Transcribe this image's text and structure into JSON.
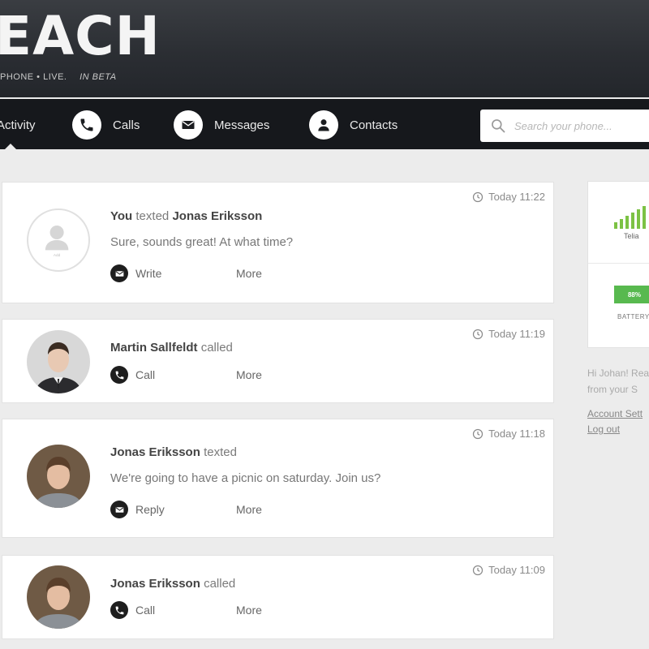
{
  "app": {
    "logo": "EACH",
    "tagline": "PHONE • LIVE.",
    "beta": "IN BETA"
  },
  "nav": {
    "items": [
      {
        "label": "Activity",
        "icon": "activity-icon",
        "active": true
      },
      {
        "label": "Calls",
        "icon": "phone-icon"
      },
      {
        "label": "Messages",
        "icon": "envelope-icon"
      },
      {
        "label": "Contacts",
        "icon": "person-icon"
      }
    ]
  },
  "search": {
    "placeholder": "Search your phone..."
  },
  "feed": [
    {
      "timestamp": "Today 11:22",
      "actor": "You",
      "verb": "texted",
      "target": "Jonas Eriksson",
      "message": "Sure, sounds great! At what time?",
      "action": "Write",
      "action_icon": "envelope-icon",
      "more": "More",
      "avatar": "placeholder"
    },
    {
      "timestamp": "Today 11:19",
      "actor": "Martin Sallfeldt",
      "verb": "called",
      "message": "",
      "action": "Call",
      "action_icon": "phone-icon",
      "more": "More",
      "avatar": "photo-martin"
    },
    {
      "timestamp": "Today 11:18",
      "actor": "Jonas Eriksson",
      "verb": "texted",
      "message": "We're going to have a picnic on saturday. Join us?",
      "action": "Reply",
      "action_icon": "envelope-icon",
      "more": "More",
      "avatar": "photo-jonas"
    },
    {
      "timestamp": "Today 11:09",
      "actor": "Jonas Eriksson",
      "verb": "called",
      "message": "",
      "action": "Call",
      "action_icon": "phone-icon",
      "more": "More",
      "avatar": "photo-jonas"
    }
  ],
  "sidebar": {
    "carrier": "Telia",
    "battery_value": "88%",
    "battery_label": "BATTERY",
    "greeting_line1": "Hi Johan! Rea",
    "greeting_line2": "from your S",
    "account_settings": "Account Sett",
    "log_out": "Log out"
  },
  "colors": {
    "header": "#2b2e33",
    "nav": "#16181c",
    "accent_green": "#7cc244"
  }
}
